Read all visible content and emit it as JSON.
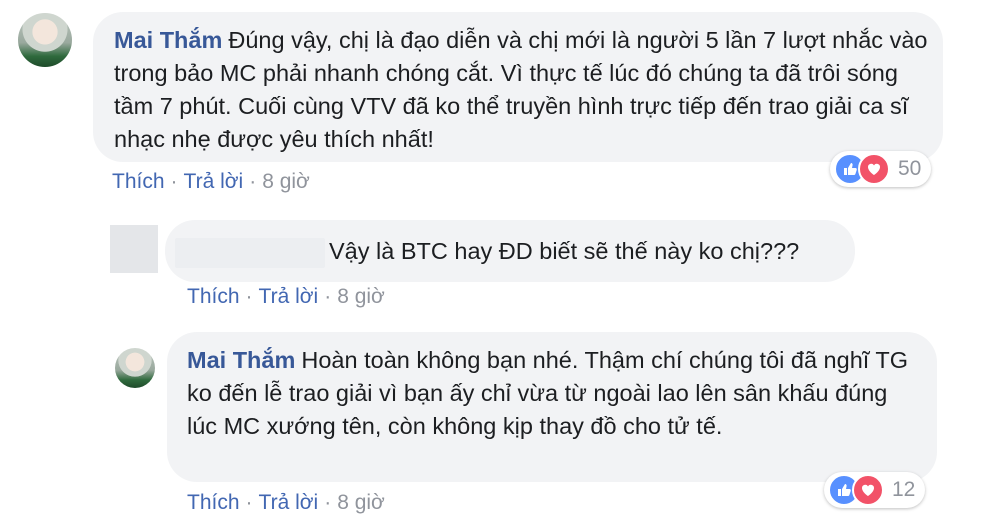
{
  "comments": [
    {
      "author": "Mai Thắm",
      "text": "Đúng vậy, chị là đạo diễn và chị mới là người 5 lần 7 lượt nhắc vào trong bảo MC phải nhanh chóng cắt. Vì thực tế lúc đó chúng ta đã trôi sóng tầm 7 phút. Cuối cùng VTV đã ko thể truyền hình trực tiếp đến trao giải ca sĩ nhạc nhẹ được yêu thích nhất!",
      "like_label": "Thích",
      "reply_label": "Trả lời",
      "time": "8 giờ",
      "reaction_count": "50"
    },
    {
      "author": "",
      "text": "Vậy là BTC hay ĐD biết sẽ thế này ko chị???",
      "like_label": "Thích",
      "reply_label": "Trả lời",
      "time": "8 giờ"
    },
    {
      "author": "Mai Thắm",
      "text": "Hoàn toàn không bạn nhé. Thậm chí chúng tôi đã nghĩ TG ko đến lễ trao giải vì bạn ấy chỉ vừa từ ngoài lao lên sân khấu đúng lúc MC xướng tên, còn không kịp thay đồ cho tử tế.",
      "like_label": "Thích",
      "reply_label": "Trả lời",
      "time": "8 giờ",
      "reaction_count": "12"
    }
  ],
  "icons": {
    "like": "like-reaction-icon",
    "love": "love-reaction-icon"
  },
  "colors": {
    "author": "#385898",
    "link": "#4267b2",
    "bubble": "#f2f3f5",
    "meta": "#90949c",
    "like": "#5890ff",
    "love": "#f25268"
  }
}
